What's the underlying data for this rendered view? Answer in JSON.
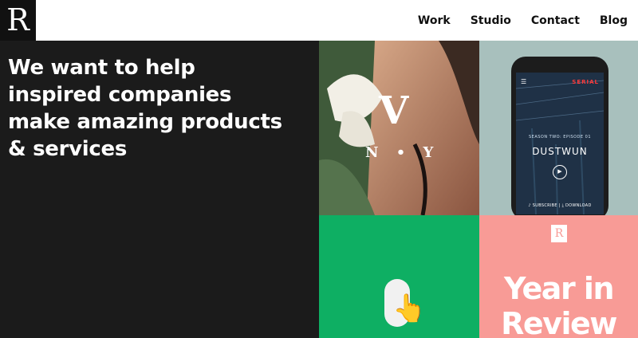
{
  "header": {
    "logo": "R",
    "nav": [
      "Work",
      "Studio",
      "Contact",
      "Blog"
    ]
  },
  "hero": {
    "headline": "We want to help inspired companies make amazing products & services"
  },
  "tiles": {
    "vny": {
      "v": "V",
      "ny": "N • Y"
    },
    "serial": {
      "badge": "SERIAL",
      "episode": "SEASON TWO: EPISODE 01",
      "title": "DUSTWUN",
      "actions": "♪ SUBSCRIBE  |  ⤓ DOWNLOAD"
    },
    "review": {
      "badge": "R",
      "headline": "Year in Review"
    }
  },
  "colors": {
    "hero_bg": "#1b1b1b",
    "green_tile": "#0eaf63",
    "pink_tile": "#f89b96",
    "serial_bg": "#a8c0bd"
  },
  "icons": [
    "hamburger-menu-icon",
    "play-icon",
    "pointing-hand-icon"
  ]
}
